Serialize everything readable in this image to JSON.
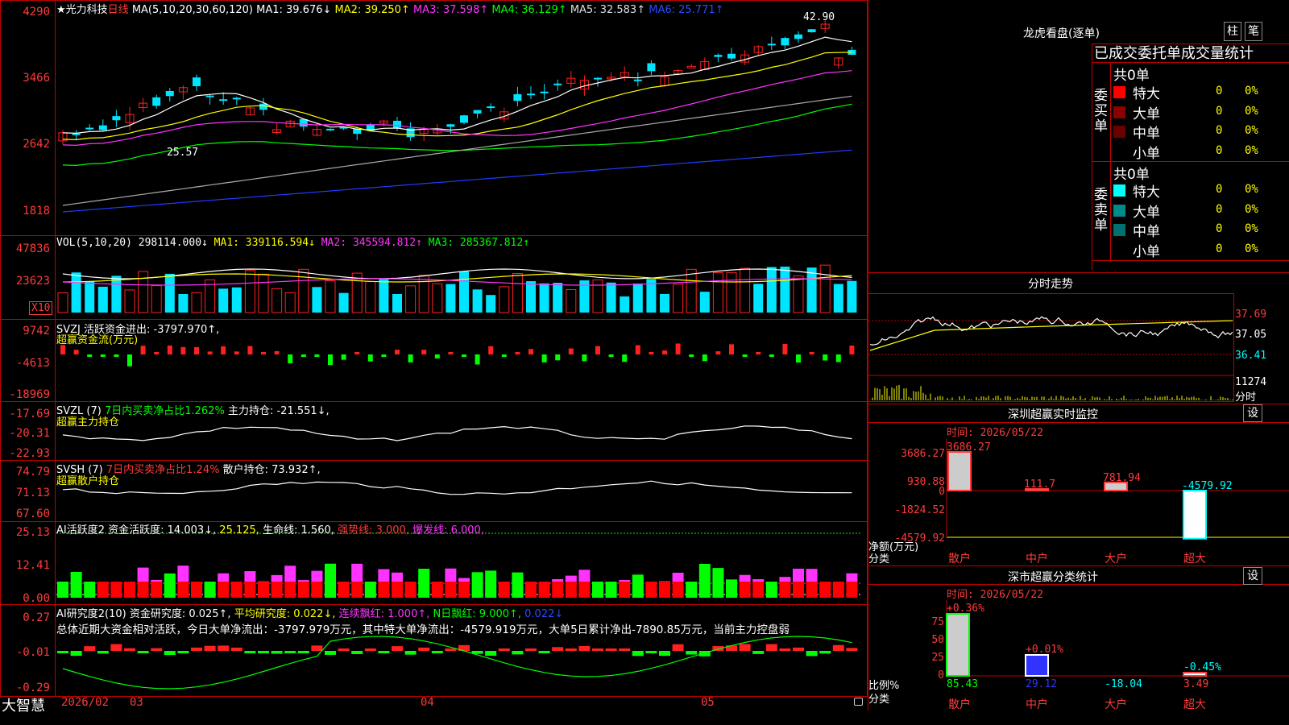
{
  "colors": {
    "up": "#ff2020",
    "down": "#00e5ff",
    "ma1": "#ffffff",
    "ma2": "#ffff00",
    "ma3": "#ff33ff",
    "ma4": "#00ff00",
    "ma5": "#aaaaaa",
    "ma6": "#1f3cff",
    "border": "#c00000",
    "green": "#00ff00",
    "magenta": "#ff33ff"
  },
  "main": {
    "title_star": "★光力科技",
    "period": "日线",
    "ma_params": "MA(5,10,20,30,60,120)",
    "ma1": "MA1: 39.676↓",
    "ma2": "MA2: 39.250↑",
    "ma3": "MA3: 37.598↑",
    "ma4": "MA4: 36.129↑",
    "ma5": "MA5: 32.583↑",
    "ma6": "MA6: 25.771↑",
    "yticks": [
      "4290",
      "3466",
      "2642",
      "1818"
    ],
    "high_label": "42.90",
    "low_label": "25.57"
  },
  "vol": {
    "params": "VOL(5,10,20)",
    "value": "298114.000↓",
    "ma1": "MA1: 339116.594↓",
    "ma2": "MA2: 345594.812↑",
    "ma3": "MA3: 285367.812↑",
    "yticks": [
      "47836",
      "23623"
    ],
    "unit": "X10"
  },
  "svzj": {
    "header": "SVZJ  活跃资金进出: -3797.970↑,",
    "sub": "超赢资金流(万元)",
    "yticks": [
      "9742",
      "-4613",
      "-18969"
    ]
  },
  "svzl": {
    "header": "SVZL (7)",
    "ratio": "7日内买卖净占比1.262%",
    "hold": "主力持仓: -21.551↓,",
    "sub": "超赢主力持仓",
    "yticks": [
      "-17.69",
      "-20.31",
      "-22.93"
    ]
  },
  "svsh": {
    "header": "SVSH (7)",
    "ratio": "7日内买卖净占比1.24%",
    "hold": "散户持仓: 73.932↑,",
    "sub": "超赢散户持仓",
    "yticks": [
      "74.79",
      "71.13",
      "67.60"
    ]
  },
  "ai1": {
    "header": "AI活跃度2 资金活跃度: 14.003↓,",
    "v2": "25.125,",
    "life": "生命线: 1.560,",
    "strong": "强势线: 3.000,",
    "burst": "爆发线: 6.000,",
    "yticks": [
      "25.13",
      "12.41",
      "0.00"
    ]
  },
  "ai2": {
    "header": "AI研究度2(10) 资金研究度: 0.025↑,",
    "avg": "平均研究度: 0.022↓,",
    "lian": "连续飘红: 1.000↑,",
    "nday": "N日飘红: 9.000↑,",
    "last": "0.022↓",
    "comment": "总体近期大资金相对活跃，今日大单净流出：-3797.979万元，其中特大单净流出：-4579.919万元，大单5日累计净出-7890.85万元，当前主力控盘弱",
    "yticks": [
      "0.27",
      "-0.01",
      "-0.29"
    ]
  },
  "bottom": {
    "logo": "大智慧",
    "xdates": [
      "2026/02",
      "03",
      "04",
      "05"
    ]
  },
  "lhb": {
    "title": "龙虎看盘(逐单)",
    "btn1": "柱",
    "btn2": "笔",
    "header": "已成交委托单成交量统计",
    "buy_total": "共0单",
    "sell_total": "共0单",
    "buy_side": "委买单",
    "sell_side": "委卖单",
    "buy_rows": [
      {
        "label": "特大",
        "v": "0",
        "p": "0%",
        "c": "#ff0000"
      },
      {
        "label": "大单",
        "v": "0",
        "p": "0%",
        "c": "#8b0000"
      },
      {
        "label": "中单",
        "v": "0",
        "p": "0%",
        "c": "#6b0000"
      },
      {
        "label": "小单",
        "v": "0",
        "p": "0%",
        "c": "#000000"
      }
    ],
    "sell_rows": [
      {
        "label": "特大",
        "v": "0",
        "p": "0%",
        "c": "#00ffff"
      },
      {
        "label": "大单",
        "v": "0",
        "p": "0%",
        "c": "#008b8b"
      },
      {
        "label": "中单",
        "v": "0",
        "p": "0%",
        "c": "#007070"
      },
      {
        "label": "小单",
        "v": "0",
        "p": "0%",
        "c": "#000000"
      }
    ]
  },
  "fenshi": {
    "title": "分时走势",
    "prices": [
      "37.69",
      "37.05",
      "36.41"
    ],
    "vol": "11274",
    "unit": "分时"
  },
  "monitor": {
    "title": "深圳超赢实时监控",
    "btn": "设",
    "time": "时间: 2026/05/22",
    "yticks": [
      "3686.27",
      "930.88",
      "0",
      "-1824.52",
      "-4579.92"
    ],
    "ylabel1": "净额(万元)",
    "ylabel2": "分类",
    "cats": [
      "散户",
      "中户",
      "大户",
      "超大"
    ],
    "values": [
      3686.27,
      111.7,
      781.94,
      -4579.92
    ],
    "labels": [
      "3686.27",
      "111.7",
      "781.94",
      "-4579.92"
    ]
  },
  "stat": {
    "title": "深市超赢分类统计",
    "btn": "设",
    "time": "时间: 2026/05/22",
    "yticks": [
      "75",
      "50",
      "25",
      "0"
    ],
    "ylabel1": "比例%",
    "ylabel2": "分类",
    "cats": [
      "散户",
      "中户",
      "大户",
      "超大"
    ],
    "pct": [
      "+0.36%",
      "+0.01%",
      "",
      "-0.45%"
    ],
    "values": [
      "85.43",
      "29.12",
      "-18.04",
      "3.49"
    ]
  }
}
